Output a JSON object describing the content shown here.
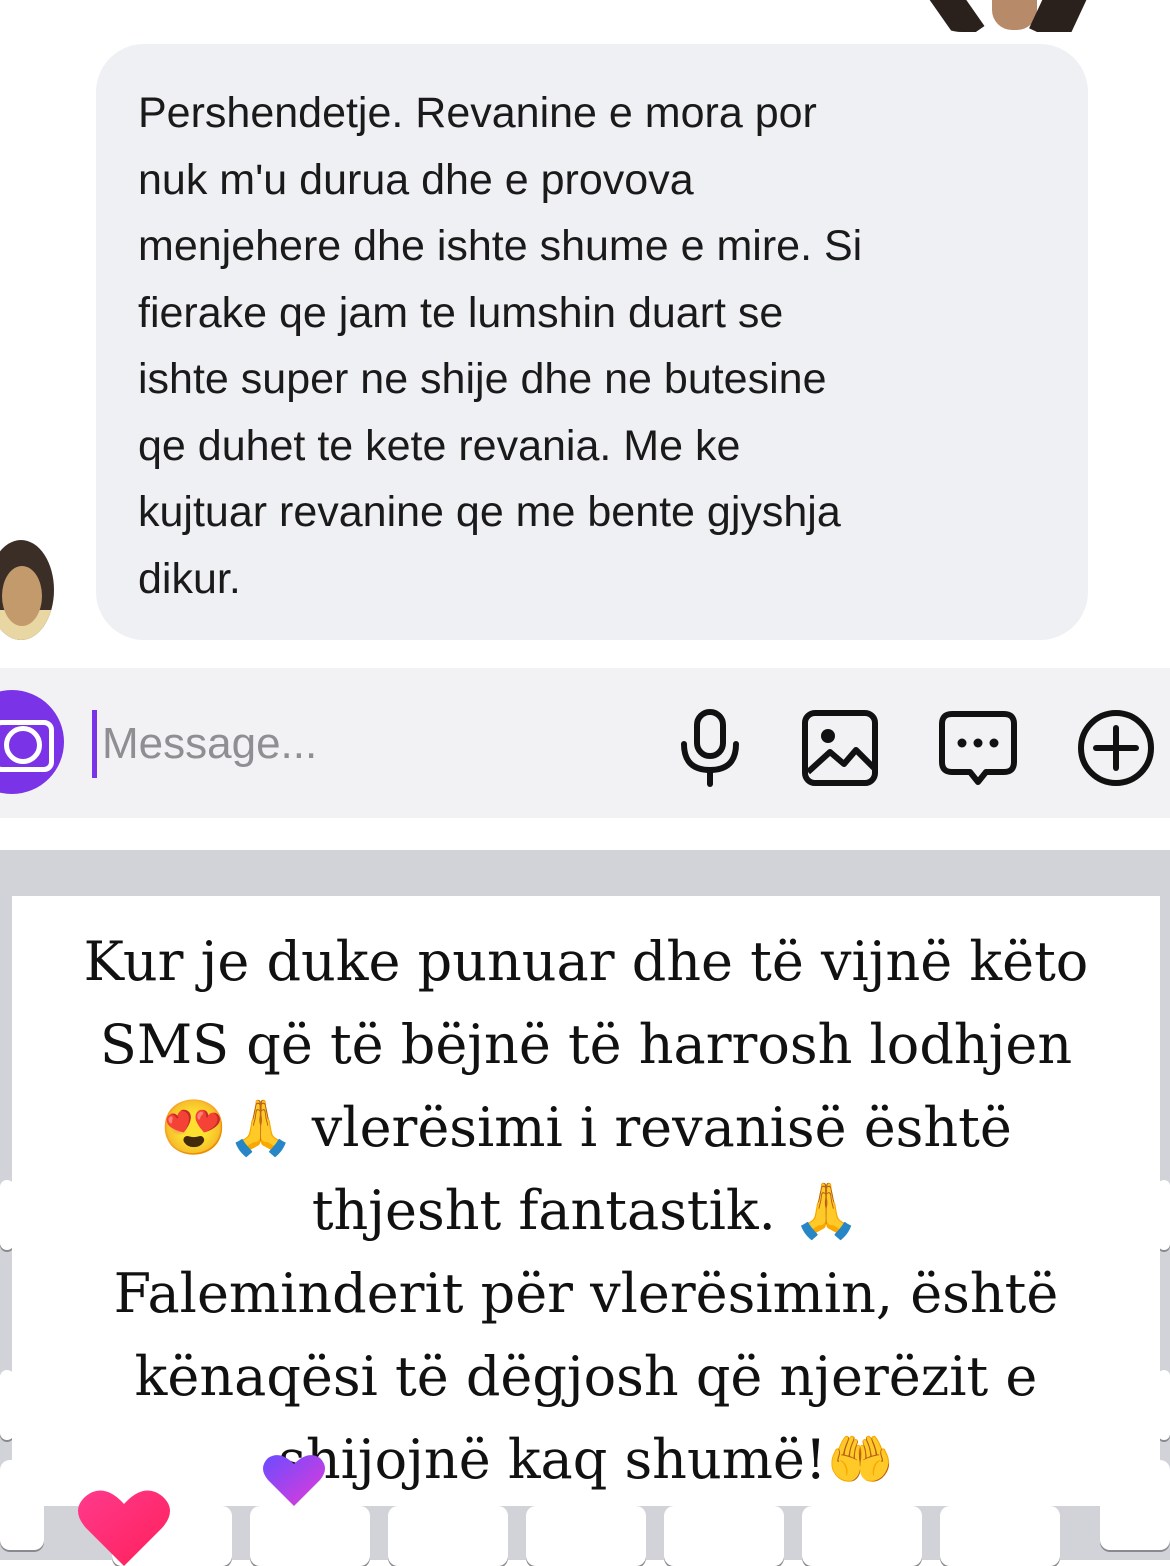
{
  "chat": {
    "incoming_message": "Pershendetje. Revanine e mora por\nnuk m'u durua dhe e provova\nmenjehere dhe ishte shume e mire. Si\nfierake qe jam te lumshin duart se\nishte super ne shije dhe ne butesine\nqe duhet te kete revania. Me ke\nkujtuar revanine qe me bente gjyshja\ndikur."
  },
  "composer": {
    "placeholder": "Message...",
    "icons": [
      "camera-icon",
      "microphone-icon",
      "gallery-icon",
      "sticker-icon",
      "plus-icon"
    ],
    "accent": "#7b33e8"
  },
  "caption": {
    "text": "Kur je duke punuar dhe të vijnë këto\nSMS që të bëjnë të harrosh lodhjen\n😍🙏 vlerësimi i revanisë është\nthjesht fantastik. 🙏\nFaleminderit për vlerësimin, është\nkënaqësi të dëgjosh që njerëzit e\nshijojnë kaq shumë!🤲"
  },
  "reactions": [
    "heart-icon",
    "heart-icon"
  ],
  "colors": {
    "bubble": "#eff0f3",
    "keyboard": "#d1d3d9",
    "heart_pink": "#ff2d6f",
    "heart_purple": "#a83cf0"
  }
}
